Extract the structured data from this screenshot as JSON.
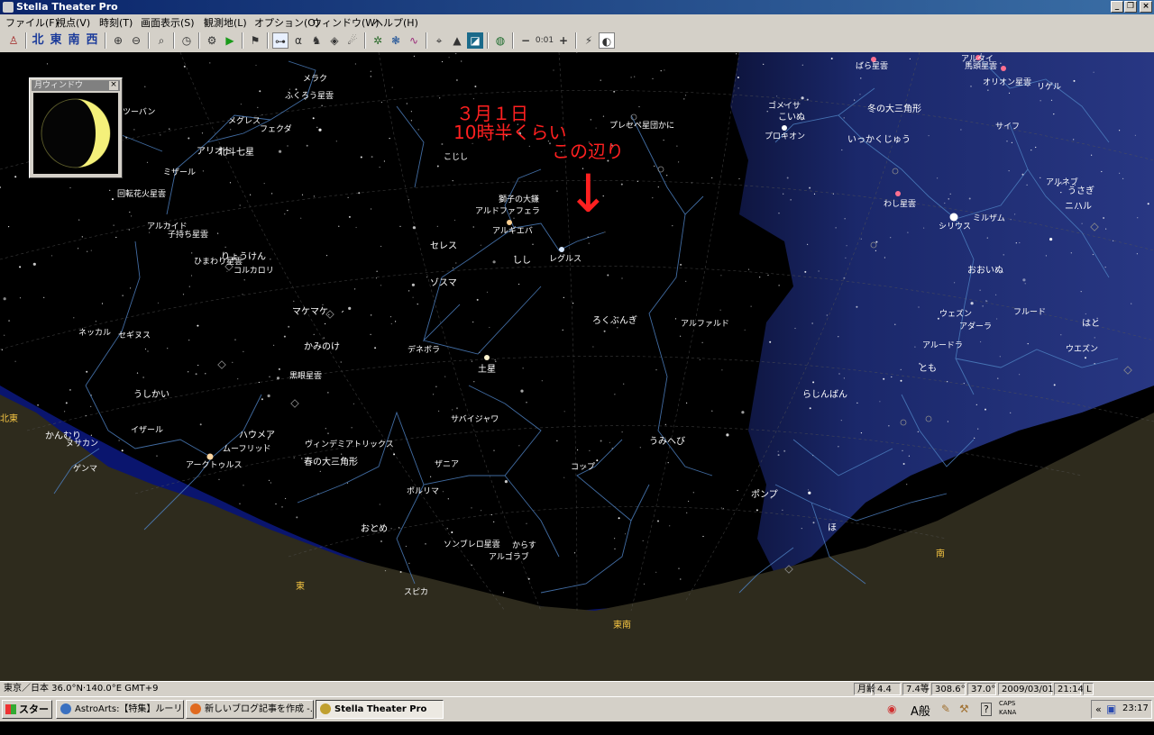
{
  "window": {
    "title": "Stella Theater Pro"
  },
  "menu": [
    "ファイル(F)",
    "視点(V)",
    "時刻(T)",
    "画面表示(S)",
    "観測地(L)",
    "オプション(O)",
    "ウィンドウ(W)",
    "ヘルプ(H)"
  ],
  "toolbar": {
    "directions": [
      "北",
      "東",
      "南",
      "西"
    ],
    "time_step": "0:01",
    "minus": "−",
    "plus": "+"
  },
  "moon_window": {
    "title": "月ウィンドウ",
    "close": "×"
  },
  "annotation": {
    "line1": "３月１日",
    "line2": "10時半くらい",
    "line3": "この辺り",
    "arrow": "↓"
  },
  "sky_labels": [
    {
      "text": "ばら星雲"
    },
    {
      "text": "馬頭星雲"
    },
    {
      "text": "アルタイ"
    },
    {
      "text": "オリオン星雲"
    },
    {
      "text": "リゲル"
    },
    {
      "text": "冬の大三角形"
    },
    {
      "text": "ゴメイサ"
    },
    {
      "text": "こいぬ"
    },
    {
      "text": "プロキオン"
    },
    {
      "text": "サイフ"
    },
    {
      "text": "いっかくじゅう"
    },
    {
      "text": "アルネブ"
    },
    {
      "text": "うさぎ"
    },
    {
      "text": "ニハル"
    },
    {
      "text": "わし星雲"
    },
    {
      "text": "ミルザム"
    },
    {
      "text": "シリウス"
    },
    {
      "text": "おおいぬ"
    },
    {
      "text": "フルード"
    },
    {
      "text": "ウェズン"
    },
    {
      "text": "アダーラ"
    },
    {
      "text": "はと"
    },
    {
      "text": "ウエズン"
    },
    {
      "text": "アルードラ"
    },
    {
      "text": "とも"
    },
    {
      "text": "らしんばん"
    },
    {
      "text": "ポンプ"
    },
    {
      "text": "ほ"
    },
    {
      "text": "南"
    },
    {
      "text": "メラク"
    },
    {
      "text": "ふくろう星雲"
    },
    {
      "text": "メグレス"
    },
    {
      "text": "フェクダ"
    },
    {
      "text": "ツーバン"
    },
    {
      "text": "アリオト"
    },
    {
      "text": "北斗七星"
    },
    {
      "text": "ミザール"
    },
    {
      "text": "回転花火星雲"
    },
    {
      "text": "アルカイド"
    },
    {
      "text": "子持ち星雲"
    },
    {
      "text": "りょうけん"
    },
    {
      "text": "ひまわり星雲"
    },
    {
      "text": "コルカロリ"
    },
    {
      "text": "プレセペ星団かに"
    },
    {
      "text": "こじし"
    },
    {
      "text": "獅子の大鎌"
    },
    {
      "text": "アルドファフェラ"
    },
    {
      "text": "アルギエバ"
    },
    {
      "text": "セレス"
    },
    {
      "text": "しし"
    },
    {
      "text": "レグルス"
    },
    {
      "text": "ゾスマ"
    },
    {
      "text": "マケマケ"
    },
    {
      "text": "ろくぶんぎ"
    },
    {
      "text": "アルファルド"
    },
    {
      "text": "かみのけ"
    },
    {
      "text": "デネボラ"
    },
    {
      "text": "ネッカル"
    },
    {
      "text": "セギヌス"
    },
    {
      "text": "黒眼星雲"
    },
    {
      "text": "土星"
    },
    {
      "text": "うしかい"
    },
    {
      "text": "北東"
    },
    {
      "text": "イザール"
    },
    {
      "text": "かんむり"
    },
    {
      "text": "ヌサカン"
    },
    {
      "text": "ハウメア"
    },
    {
      "text": "ムーフリッド"
    },
    {
      "text": "アークトゥルス"
    },
    {
      "text": "ゲンマ"
    },
    {
      "text": "ヴィンデミアトリックス"
    },
    {
      "text": "サバイジャワ"
    },
    {
      "text": "うみへび"
    },
    {
      "text": "春の大三角形"
    },
    {
      "text": "ザニア"
    },
    {
      "text": "コップ"
    },
    {
      "text": "ポルリマ"
    },
    {
      "text": "おとめ"
    },
    {
      "text": "ソンブレロ星雲"
    },
    {
      "text": "からす"
    },
    {
      "text": "アルゴラブ"
    },
    {
      "text": "東"
    },
    {
      "text": "スピカ"
    },
    {
      "text": "東南"
    }
  ],
  "statusbar": {
    "location": "東京／日本  36.0°N·140.0°E  GMT+9",
    "moon_age_label": "月齢",
    "moon_age": "4.4",
    "magnitude": "7.4等",
    "azimuth": "308.6°",
    "altitude": "37.0°",
    "date": "2009/03/01",
    "time": "21:14",
    "mode": "L"
  },
  "taskbar": {
    "start": "スタート",
    "tasks": [
      {
        "label": "AstroArts:【特集】ルーリン..."
      },
      {
        "label": "新しいブログ記事を作成 -..."
      },
      {
        "label": "Stella Theater Pro"
      }
    ],
    "ime": "A般",
    "caps": "CAPS",
    "kana": "KANA",
    "clock": "23:17"
  },
  "colors": {
    "sky": "#000000",
    "milky_way": "#1e2a6a",
    "horizon": "#2f2c1e",
    "constellation_line": "#4d7fbf",
    "label": "#ffffff",
    "direction": "#f5c542",
    "annotation": "#ff2020",
    "moon": "#f4f07a"
  }
}
